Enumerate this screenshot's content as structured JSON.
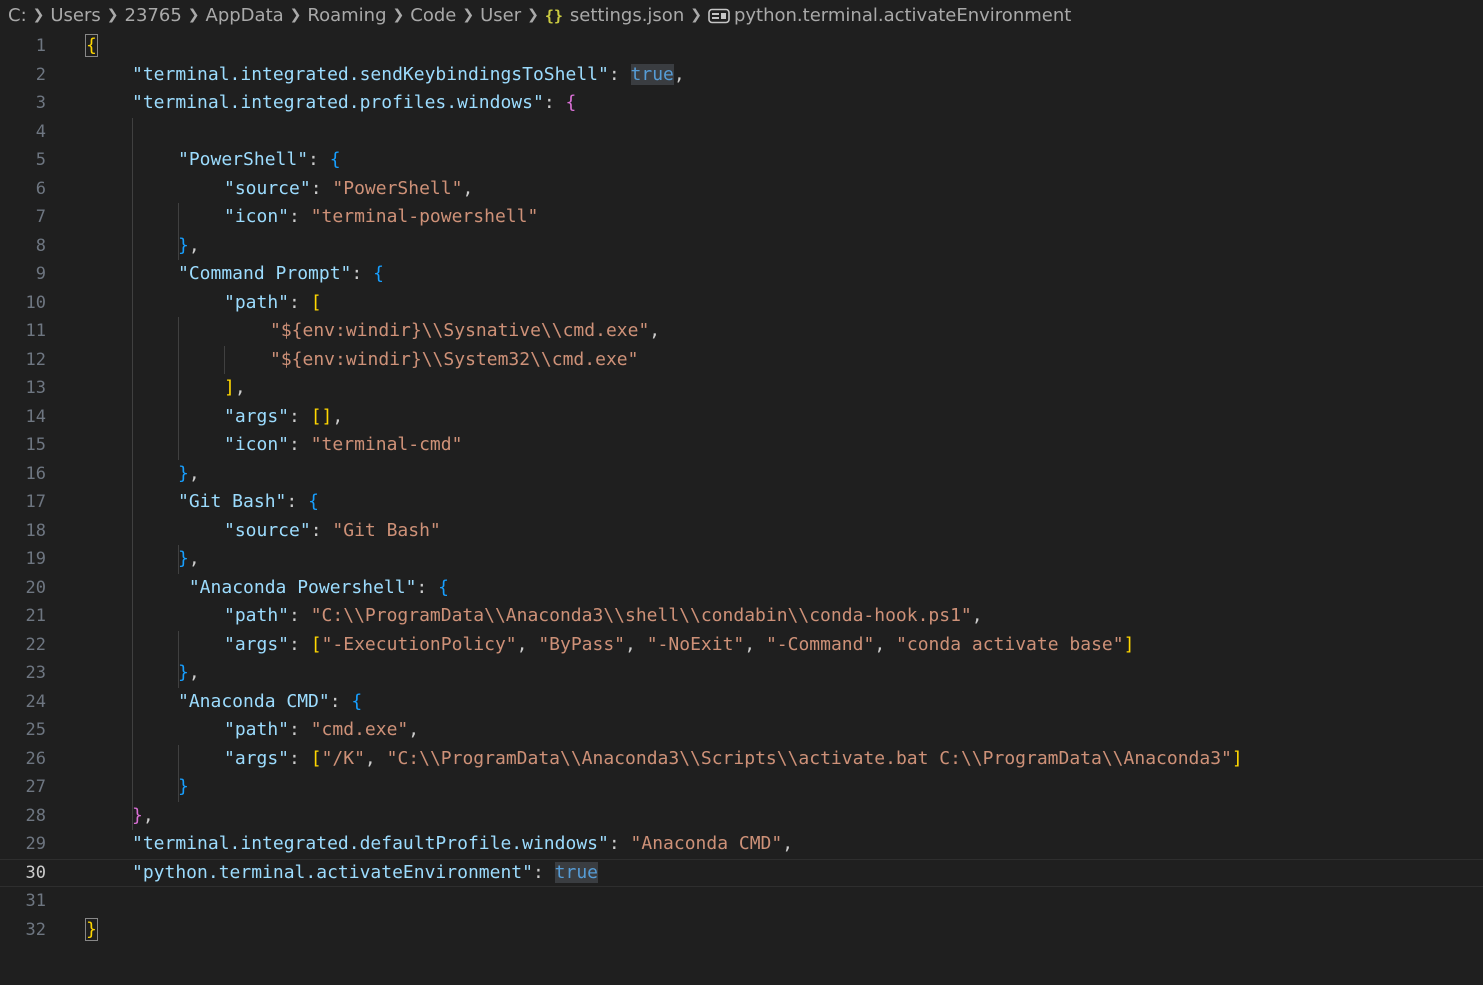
{
  "breadcrumb": {
    "items": [
      "C:",
      "Users",
      "23765",
      "AppData",
      "Roaming",
      "Code",
      "User"
    ],
    "file_icon": "json-icon",
    "file_icon_glyph": "{}",
    "file": "settings.json",
    "symbol_icon": "symbol-key-icon",
    "symbol": "python.terminal.activateEnvironment"
  },
  "editor": {
    "current_line": 30,
    "lines": [
      {
        "n": "1",
        "indent": 0,
        "tokens": [
          {
            "t": "{",
            "c": "y bm"
          }
        ]
      },
      {
        "n": "2",
        "indent": 1,
        "tokens": [
          {
            "t": "\"terminal.integrated.sendKeybindingsToShell\"",
            "c": "k"
          },
          {
            "t": ": ",
            "c": "p"
          },
          {
            "t": "true",
            "c": "b hl"
          },
          {
            "t": ",",
            "c": "p"
          }
        ]
      },
      {
        "n": "3",
        "indent": 1,
        "tokens": [
          {
            "t": "\"terminal.integrated.profiles.windows\"",
            "c": "k"
          },
          {
            "t": ": ",
            "c": "p"
          },
          {
            "t": "{",
            "c": "m"
          }
        ]
      },
      {
        "n": "4",
        "indent": 0,
        "tokens": []
      },
      {
        "n": "5",
        "indent": 2,
        "tokens": [
          {
            "t": "\"PowerShell\"",
            "c": "k"
          },
          {
            "t": ": ",
            "c": "p"
          },
          {
            "t": "{",
            "c": "bl"
          }
        ]
      },
      {
        "n": "6",
        "indent": 3,
        "tokens": [
          {
            "t": "\"source\"",
            "c": "k"
          },
          {
            "t": ": ",
            "c": "p"
          },
          {
            "t": "\"PowerShell\"",
            "c": "s"
          },
          {
            "t": ",",
            "c": "p"
          }
        ]
      },
      {
        "n": "7",
        "indent": 3,
        "tokens": [
          {
            "t": "\"icon\"",
            "c": "k"
          },
          {
            "t": ": ",
            "c": "p"
          },
          {
            "t": "\"terminal-powershell\"",
            "c": "s"
          }
        ]
      },
      {
        "n": "8",
        "indent": 2,
        "tokens": [
          {
            "t": "}",
            "c": "bl"
          },
          {
            "t": ",",
            "c": "p"
          }
        ]
      },
      {
        "n": "9",
        "indent": 2,
        "tokens": [
          {
            "t": "\"Command Prompt\"",
            "c": "k"
          },
          {
            "t": ": ",
            "c": "p"
          },
          {
            "t": "{",
            "c": "bl"
          }
        ]
      },
      {
        "n": "10",
        "indent": 3,
        "tokens": [
          {
            "t": "\"path\"",
            "c": "k"
          },
          {
            "t": ": ",
            "c": "p"
          },
          {
            "t": "[",
            "c": "y"
          }
        ]
      },
      {
        "n": "11",
        "indent": 4,
        "tokens": [
          {
            "t": "\"${env:windir}\\\\Sysnative\\\\cmd.exe\"",
            "c": "s"
          },
          {
            "t": ",",
            "c": "p"
          }
        ]
      },
      {
        "n": "12",
        "indent": 4,
        "tokens": [
          {
            "t": "\"${env:windir}\\\\System32\\\\cmd.exe\"",
            "c": "s"
          }
        ]
      },
      {
        "n": "13",
        "indent": 3,
        "tokens": [
          {
            "t": "]",
            "c": "y"
          },
          {
            "t": ",",
            "c": "p"
          }
        ]
      },
      {
        "n": "14",
        "indent": 3,
        "tokens": [
          {
            "t": "\"args\"",
            "c": "k"
          },
          {
            "t": ": ",
            "c": "p"
          },
          {
            "t": "[]",
            "c": "y"
          },
          {
            "t": ",",
            "c": "p"
          }
        ]
      },
      {
        "n": "15",
        "indent": 3,
        "tokens": [
          {
            "t": "\"icon\"",
            "c": "k"
          },
          {
            "t": ": ",
            "c": "p"
          },
          {
            "t": "\"terminal-cmd\"",
            "c": "s"
          }
        ]
      },
      {
        "n": "16",
        "indent": 2,
        "tokens": [
          {
            "t": "}",
            "c": "bl"
          },
          {
            "t": ",",
            "c": "p"
          }
        ]
      },
      {
        "n": "17",
        "indent": 2,
        "tokens": [
          {
            "t": "\"Git Bash\"",
            "c": "k"
          },
          {
            "t": ": ",
            "c": "p"
          },
          {
            "t": "{",
            "c": "bl"
          }
        ]
      },
      {
        "n": "18",
        "indent": 3,
        "tokens": [
          {
            "t": "\"source\"",
            "c": "k"
          },
          {
            "t": ": ",
            "c": "p"
          },
          {
            "t": "\"Git Bash\"",
            "c": "s"
          }
        ]
      },
      {
        "n": "19",
        "indent": 2,
        "tokens": [
          {
            "t": "}",
            "c": "bl"
          },
          {
            "t": ",",
            "c": "p"
          }
        ]
      },
      {
        "n": "20",
        "indent": 2,
        "tokens": [
          {
            "t": " ",
            "c": "p"
          },
          {
            "t": "\"Anaconda Powershell\"",
            "c": "k"
          },
          {
            "t": ": ",
            "c": "p"
          },
          {
            "t": "{",
            "c": "bl"
          }
        ]
      },
      {
        "n": "21",
        "indent": 3,
        "tokens": [
          {
            "t": "\"path\"",
            "c": "k"
          },
          {
            "t": ": ",
            "c": "p"
          },
          {
            "t": "\"C:\\\\ProgramData\\\\Anaconda3\\\\shell\\\\condabin\\\\conda-hook.ps1\"",
            "c": "s"
          },
          {
            "t": ",",
            "c": "p"
          }
        ]
      },
      {
        "n": "22",
        "indent": 3,
        "tokens": [
          {
            "t": "\"args\"",
            "c": "k"
          },
          {
            "t": ": ",
            "c": "p"
          },
          {
            "t": "[",
            "c": "y"
          },
          {
            "t": "\"-ExecutionPolicy\"",
            "c": "s"
          },
          {
            "t": ", ",
            "c": "p"
          },
          {
            "t": "\"ByPass\"",
            "c": "s"
          },
          {
            "t": ", ",
            "c": "p"
          },
          {
            "t": "\"-NoExit\"",
            "c": "s"
          },
          {
            "t": ", ",
            "c": "p"
          },
          {
            "t": "\"-Command\"",
            "c": "s"
          },
          {
            "t": ", ",
            "c": "p"
          },
          {
            "t": "\"conda activate base\"",
            "c": "s"
          },
          {
            "t": "]",
            "c": "y"
          }
        ]
      },
      {
        "n": "23",
        "indent": 2,
        "tokens": [
          {
            "t": "}",
            "c": "bl"
          },
          {
            "t": ",",
            "c": "p"
          }
        ]
      },
      {
        "n": "24",
        "indent": 2,
        "tokens": [
          {
            "t": "\"Anaconda CMD\"",
            "c": "k"
          },
          {
            "t": ": ",
            "c": "p"
          },
          {
            "t": "{",
            "c": "bl"
          }
        ]
      },
      {
        "n": "25",
        "indent": 3,
        "tokens": [
          {
            "t": "\"path\"",
            "c": "k"
          },
          {
            "t": ": ",
            "c": "p"
          },
          {
            "t": "\"cmd.exe\"",
            "c": "s"
          },
          {
            "t": ",",
            "c": "p"
          }
        ]
      },
      {
        "n": "26",
        "indent": 3,
        "tokens": [
          {
            "t": "\"args\"",
            "c": "k"
          },
          {
            "t": ": ",
            "c": "p"
          },
          {
            "t": "[",
            "c": "y"
          },
          {
            "t": "\"/K\"",
            "c": "s"
          },
          {
            "t": ", ",
            "c": "p"
          },
          {
            "t": "\"C:\\\\ProgramData\\\\Anaconda3\\\\Scripts\\\\activate.bat C:\\\\ProgramData\\\\Anaconda3\"",
            "c": "s"
          },
          {
            "t": "]",
            "c": "y"
          }
        ]
      },
      {
        "n": "27",
        "indent": 2,
        "tokens": [
          {
            "t": "}",
            "c": "bl"
          }
        ]
      },
      {
        "n": "28",
        "indent": 1,
        "tokens": [
          {
            "t": "}",
            "c": "m"
          },
          {
            "t": ",",
            "c": "p"
          }
        ]
      },
      {
        "n": "29",
        "indent": 1,
        "tokens": [
          {
            "t": "\"terminal.integrated.defaultProfile.windows\"",
            "c": "k"
          },
          {
            "t": ": ",
            "c": "p"
          },
          {
            "t": "\"Anaconda CMD\"",
            "c": "s"
          },
          {
            "t": ",",
            "c": "p"
          }
        ]
      },
      {
        "n": "30",
        "indent": 1,
        "tokens": [
          {
            "t": "\"python.terminal.activateEnvironment\"",
            "c": "k"
          },
          {
            "t": ": ",
            "c": "p"
          },
          {
            "t": "true",
            "c": "b hl"
          }
        ]
      },
      {
        "n": "31",
        "indent": 0,
        "tokens": []
      },
      {
        "n": "32",
        "indent": 0,
        "tokens": [
          {
            "t": "}",
            "c": "y bm"
          }
        ]
      }
    ]
  }
}
